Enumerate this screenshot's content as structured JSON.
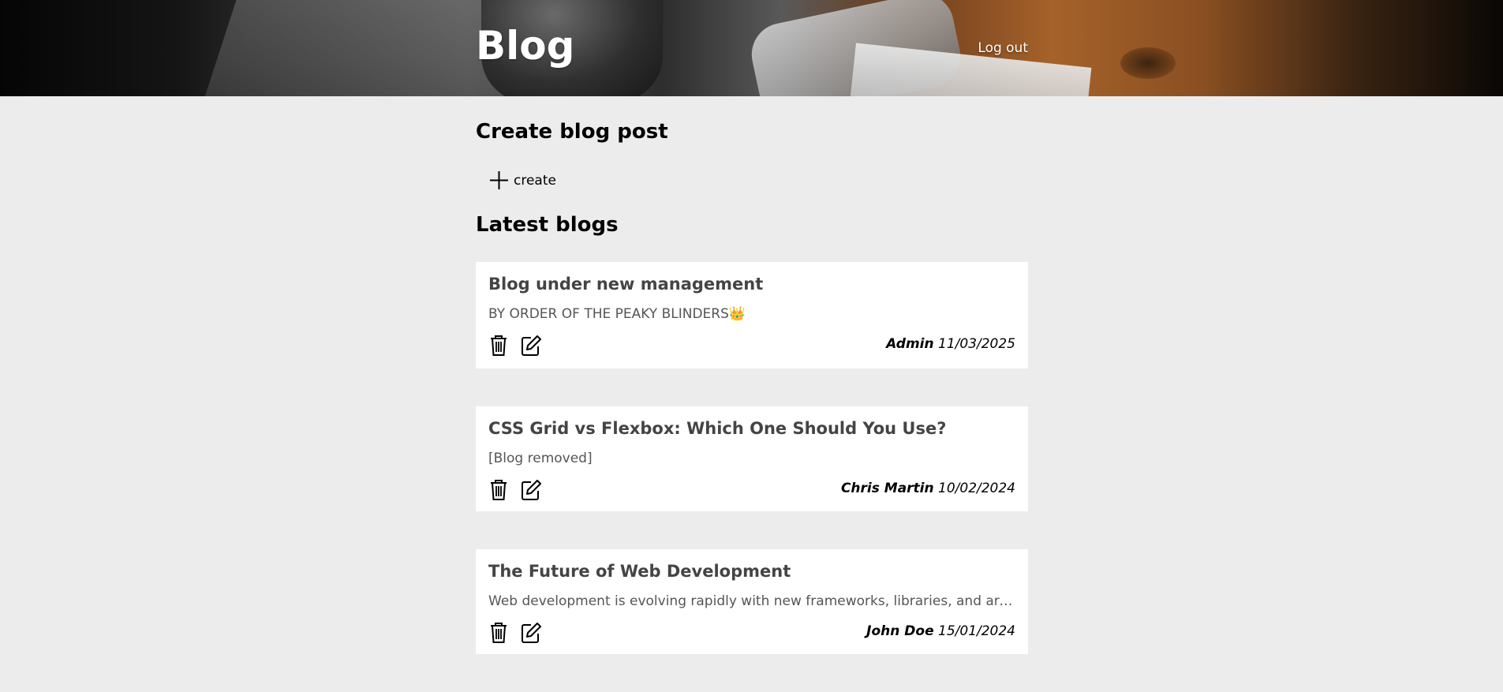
{
  "header": {
    "title": "Blog",
    "logout_label": "Log out"
  },
  "create_section": {
    "heading": "Create blog post",
    "create_label": "create"
  },
  "latest_section": {
    "heading": "Latest blogs"
  },
  "posts": [
    {
      "title": "Blog under new management",
      "body": "BY ORDER OF THE PEAKY BLINDERS👑",
      "author": "Admin",
      "date": "11/03/2025"
    },
    {
      "title": "CSS Grid vs Flexbox: Which One Should You Use?",
      "body": "[Blog removed]",
      "author": "Chris Martin",
      "date": "10/02/2024"
    },
    {
      "title": "The Future of Web Development",
      "body": "Web development is evolving rapidly with new frameworks, libraries, and architectures emerging every year.",
      "author": "John Doe",
      "date": "15/01/2024"
    }
  ],
  "icons": {
    "delete": "trash-icon",
    "edit": "edit-icon",
    "create": "plus-icon"
  },
  "colors": {
    "page_background": "#ececec",
    "card_background": "#ffffff",
    "post_title": "#444444"
  }
}
